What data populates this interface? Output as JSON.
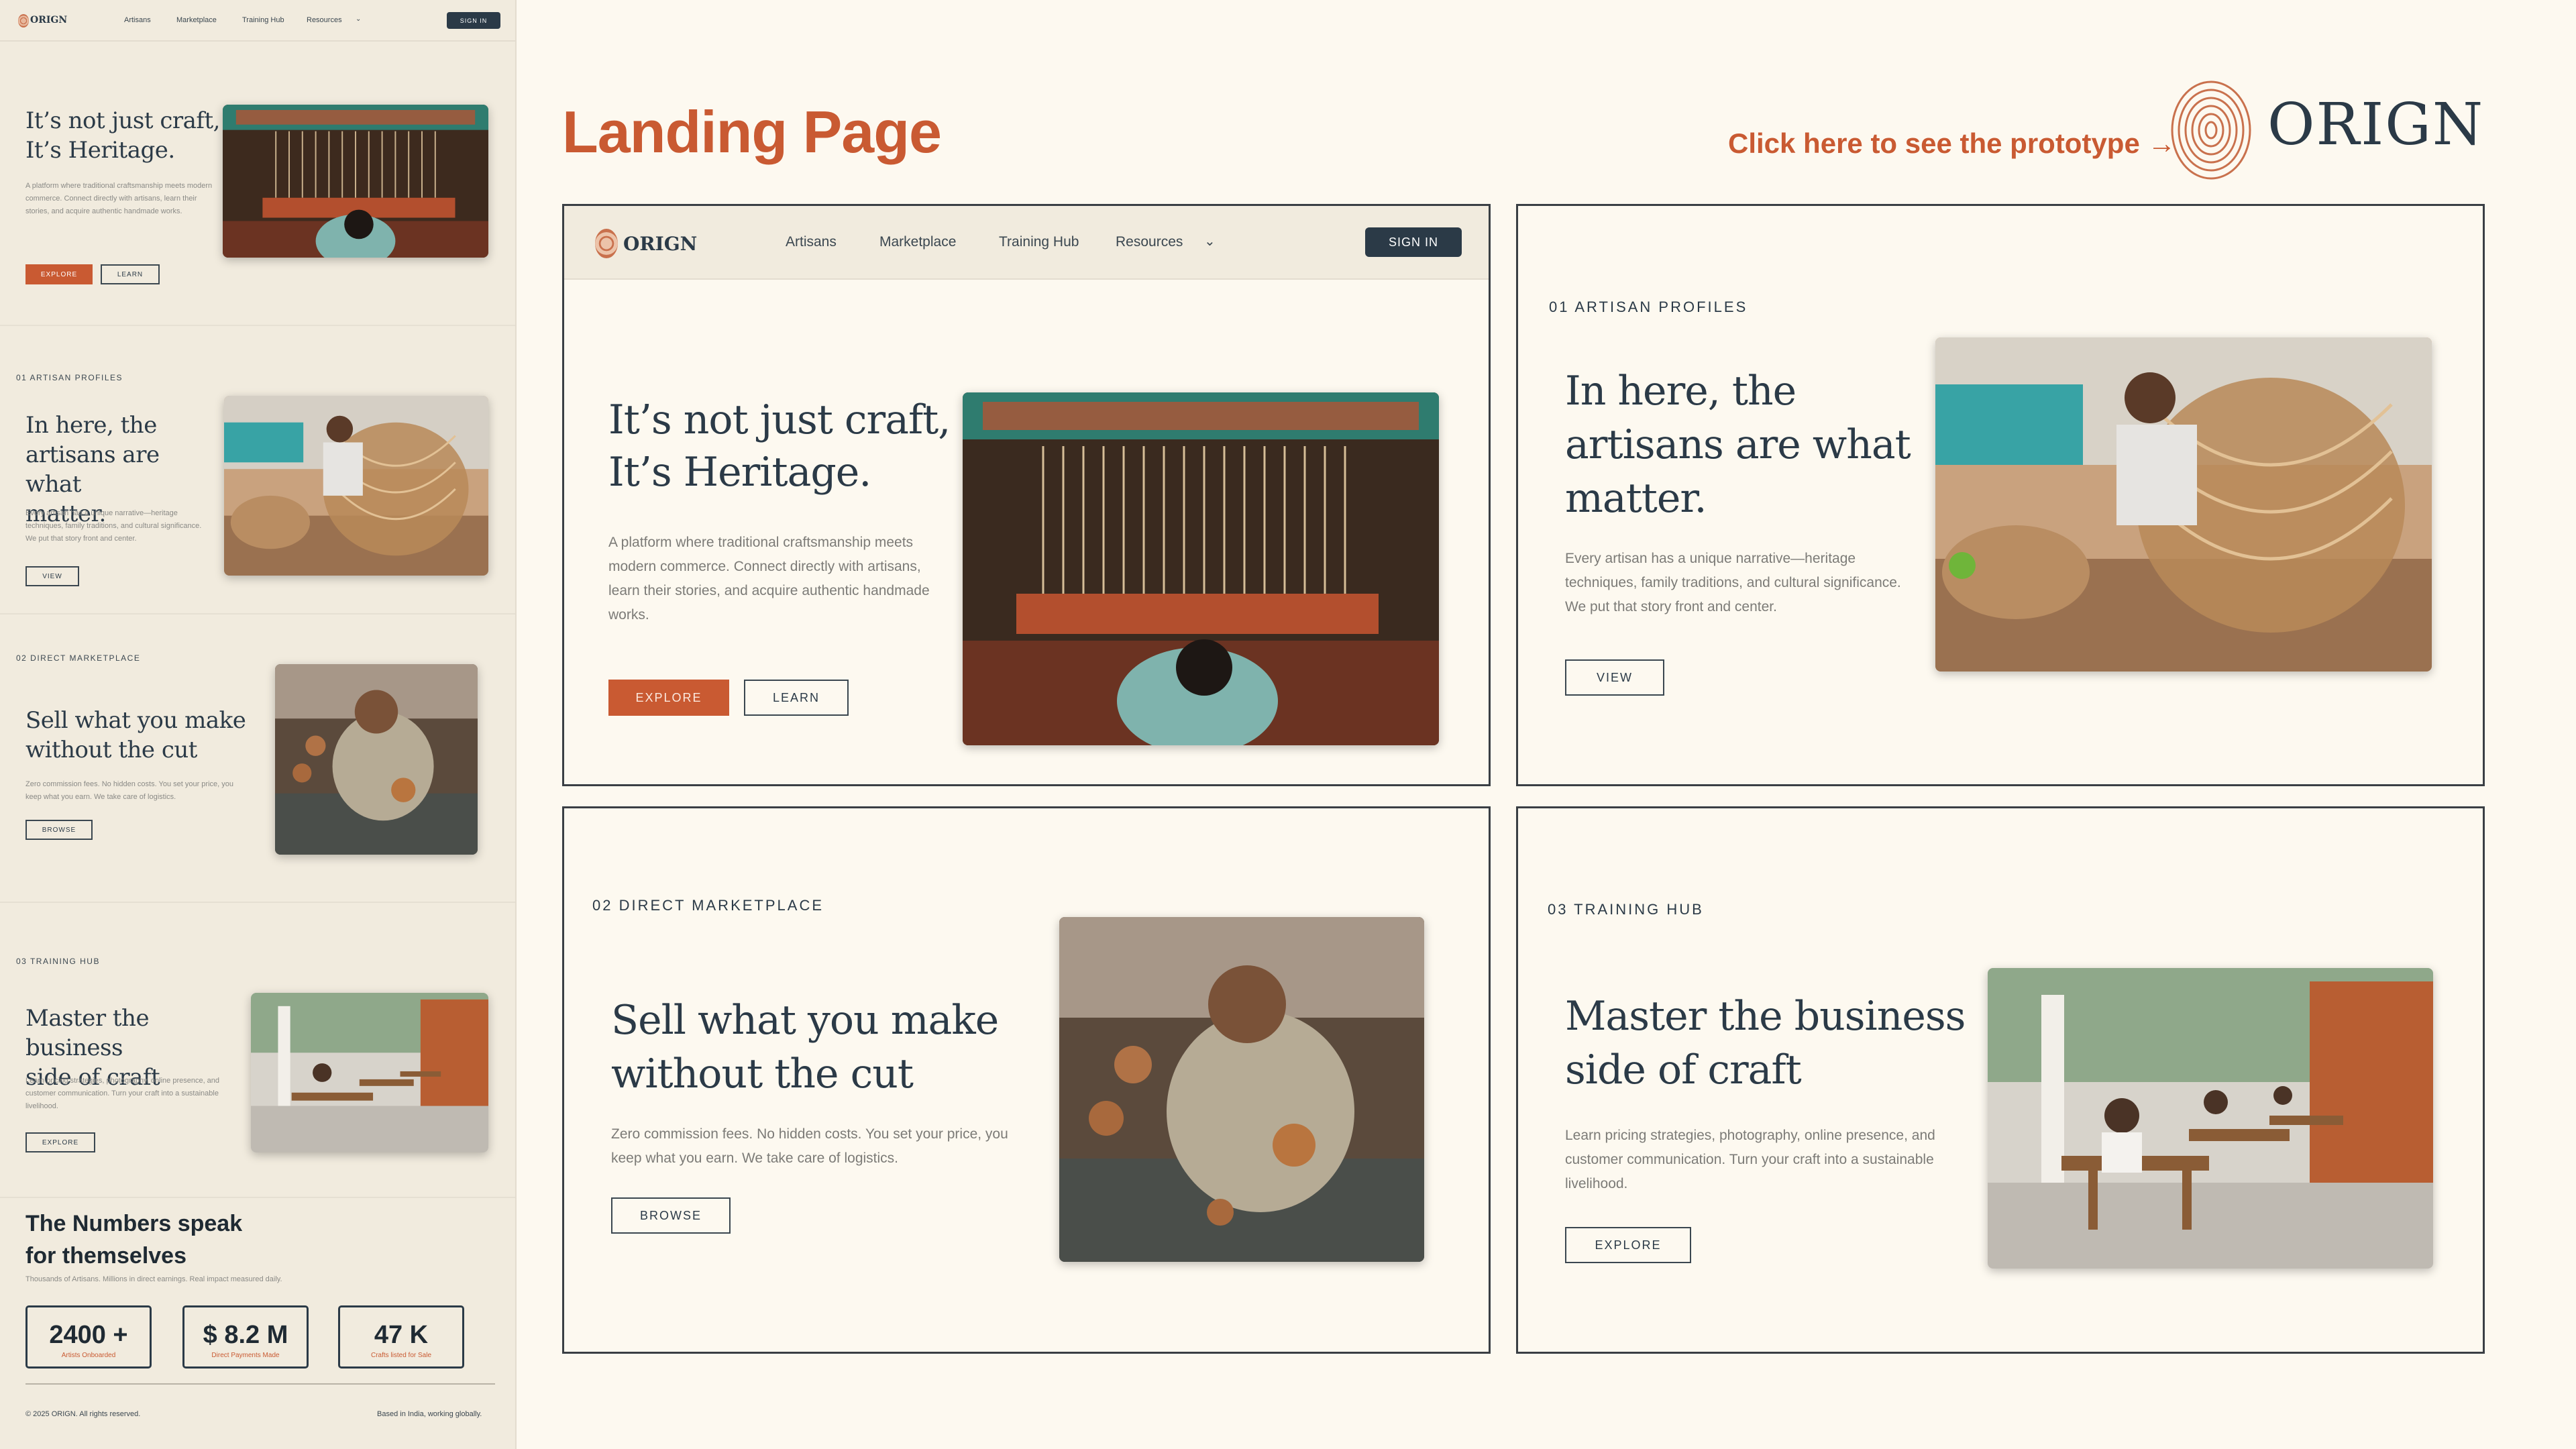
{
  "page_title": "Landing Page",
  "prototype_link": "Click here to see the prototype →",
  "brand": {
    "name": "ORIGN",
    "accent": "#c95a32",
    "ink": "#2b3a47",
    "bg": "#fdf9f0"
  },
  "nav": {
    "items": [
      "Artisans",
      "Marketplace",
      "Training Hub",
      "Resources"
    ],
    "signin": "SIGN IN"
  },
  "hero": {
    "title_line1": "It’s not just craft,",
    "title_line2": "It’s Heritage.",
    "body": "A platform where traditional craftsmanship meets modern commerce. Connect directly with artisans, learn their stories, and acquire authentic handmade works.",
    "explore": "EXPLORE",
    "learn": "LEARN"
  },
  "artisans": {
    "tag": "01 ARTISAN PROFILES",
    "title_line1": "In here, the",
    "title_line2": "artisans are what",
    "title_line3": "matter.",
    "body": "Every artisan has a unique narrative—heritage techniques, family traditions, and cultural significance. We put that story front and center.",
    "button": "VIEW"
  },
  "marketplace": {
    "tag": "02 DIRECT MARKETPLACE",
    "title_line1": "Sell what you make",
    "title_line2": "without the cut",
    "body": "Zero commission fees. No hidden costs. You set your price, you keep what you earn. We take care of logistics.",
    "button": "BROWSE"
  },
  "training": {
    "tag": "03 TRAINING HUB",
    "title_line1": "Master the business",
    "title_line2": "side of craft",
    "body": "Learn pricing strategies, photography, online presence, and customer communication. Turn your craft into a sustainable livelihood.",
    "button": "EXPLORE"
  },
  "numbers": {
    "title_line1": "The Numbers speak",
    "title_line2": "for themselves",
    "subtitle": "Thousands of Artisans. Millions in direct earnings. Real impact measured daily.",
    "stats": [
      {
        "value": "2400 +",
        "label": "Artists Onboarded"
      },
      {
        "value": "$ 8.2 M",
        "label": "Direct Payments Made"
      },
      {
        "value": "47 K",
        "label": "Crafts listed for Sale"
      }
    ]
  },
  "footer": {
    "copyright": "© 2025 ORIGN. All rights reserved.",
    "tagline": "Based in India, working globally."
  }
}
